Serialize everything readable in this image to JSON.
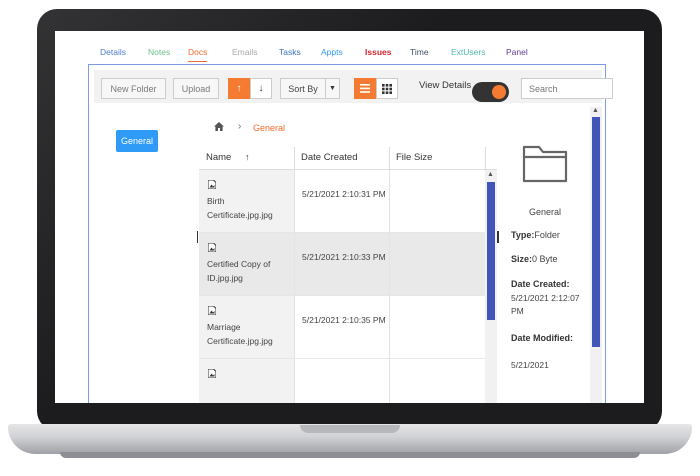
{
  "tabs": [
    {
      "label": "Details",
      "color": "#4a7bd1"
    },
    {
      "label": "Notes",
      "color": "#6cbf8c"
    },
    {
      "label": "Docs",
      "color": "#ef6c2c",
      "active": true
    },
    {
      "label": "Emails",
      "color": "#aaaaaa"
    },
    {
      "label": "Tasks",
      "color": "#3b73c5"
    },
    {
      "label": "Appts",
      "color": "#2f9bf6"
    },
    {
      "label": "Issues",
      "color": "#d6262f"
    },
    {
      "label": "Time",
      "color": "#3d4f66"
    },
    {
      "label": "ExtUsers",
      "color": "#4cb7b0"
    },
    {
      "label": "Panel",
      "color": "#5b3c8c"
    }
  ],
  "toolbar": {
    "new_folder": "New Folder",
    "upload": "Upload",
    "sort_up": "↑",
    "sort_down": "↓",
    "sort_by": "Sort By",
    "view_details": "View Details",
    "search_placeholder": "Search"
  },
  "tree": {
    "root": "General"
  },
  "breadcrumb": {
    "current": "General"
  },
  "columns": {
    "name": "Name",
    "name_sort": "↑",
    "date": "Date Created",
    "size": "File Size"
  },
  "files": [
    {
      "name": "Birth Certificate.jpg.jpg",
      "date": "5/21/2021 2:10:31 PM",
      "size": ""
    },
    {
      "name": "Certified Copy of ID.jpg.jpg",
      "date": "5/21/2021 2:10:33 PM",
      "size": ""
    },
    {
      "name": "Marriage Certificate.jpg.jpg",
      "date": "5/21/2021 2:10:35 PM",
      "size": ""
    },
    {
      "name": "",
      "date": "",
      "size": ""
    }
  ],
  "details": {
    "name": "General",
    "type_label": "Type:",
    "type_value": "Folder",
    "size_label": "Size:",
    "size_value": "0 Byte",
    "created_label": "Date Created:",
    "created_value": "5/21/2021 2:12:07 PM",
    "modified_label": "Date Modified:",
    "modified_value": "5/21/2021"
  },
  "colors": {
    "accent": "#f47b31",
    "primary": "#2f9bf6",
    "scrollbar": "#4055b7"
  }
}
